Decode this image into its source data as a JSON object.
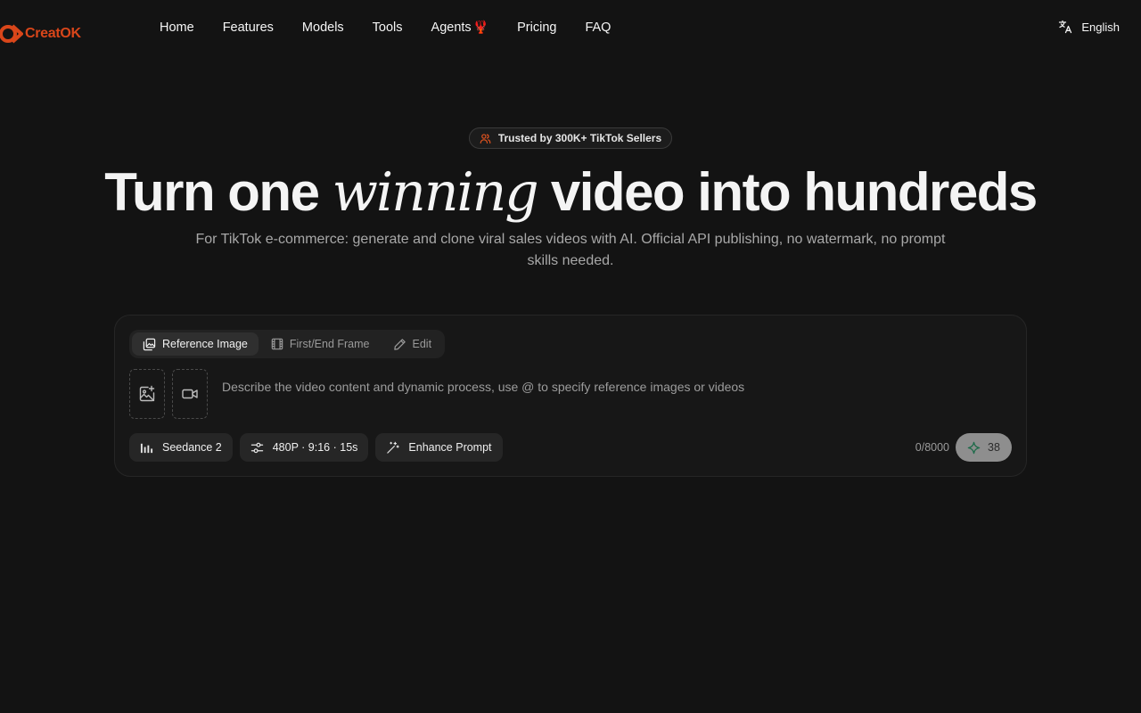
{
  "brand": {
    "name": "CreatOK",
    "accent": "#d9461a"
  },
  "nav": {
    "items": [
      {
        "label": "Home"
      },
      {
        "label": "Features"
      },
      {
        "label": "Models"
      },
      {
        "label": "Tools"
      },
      {
        "label": "Agents",
        "emoji": "🦞"
      },
      {
        "label": "Pricing"
      },
      {
        "label": "FAQ"
      }
    ],
    "language": "English"
  },
  "hero": {
    "badge": "Trusted by 300K+ TikTok Sellers",
    "title_before": "Turn one ",
    "title_emphasis": "winning",
    "title_after": " video into hundreds",
    "subtitle": "For TikTok e-commerce: generate and clone viral sales videos with AI. Official API publishing, no watermark, no prompt skills needed."
  },
  "composer": {
    "modes": [
      {
        "label": "Reference Image",
        "active": true
      },
      {
        "label": "First/End Frame",
        "active": false
      },
      {
        "label": "Edit",
        "active": false
      }
    ],
    "prompt_placeholder": "Describe the video content and dynamic process, use @ to specify reference images or videos",
    "model": "Seedance 2",
    "settings": "480P · 9:16 · 15s",
    "enhance": "Enhance Prompt",
    "char_count": "0/8000",
    "credits": "38"
  }
}
